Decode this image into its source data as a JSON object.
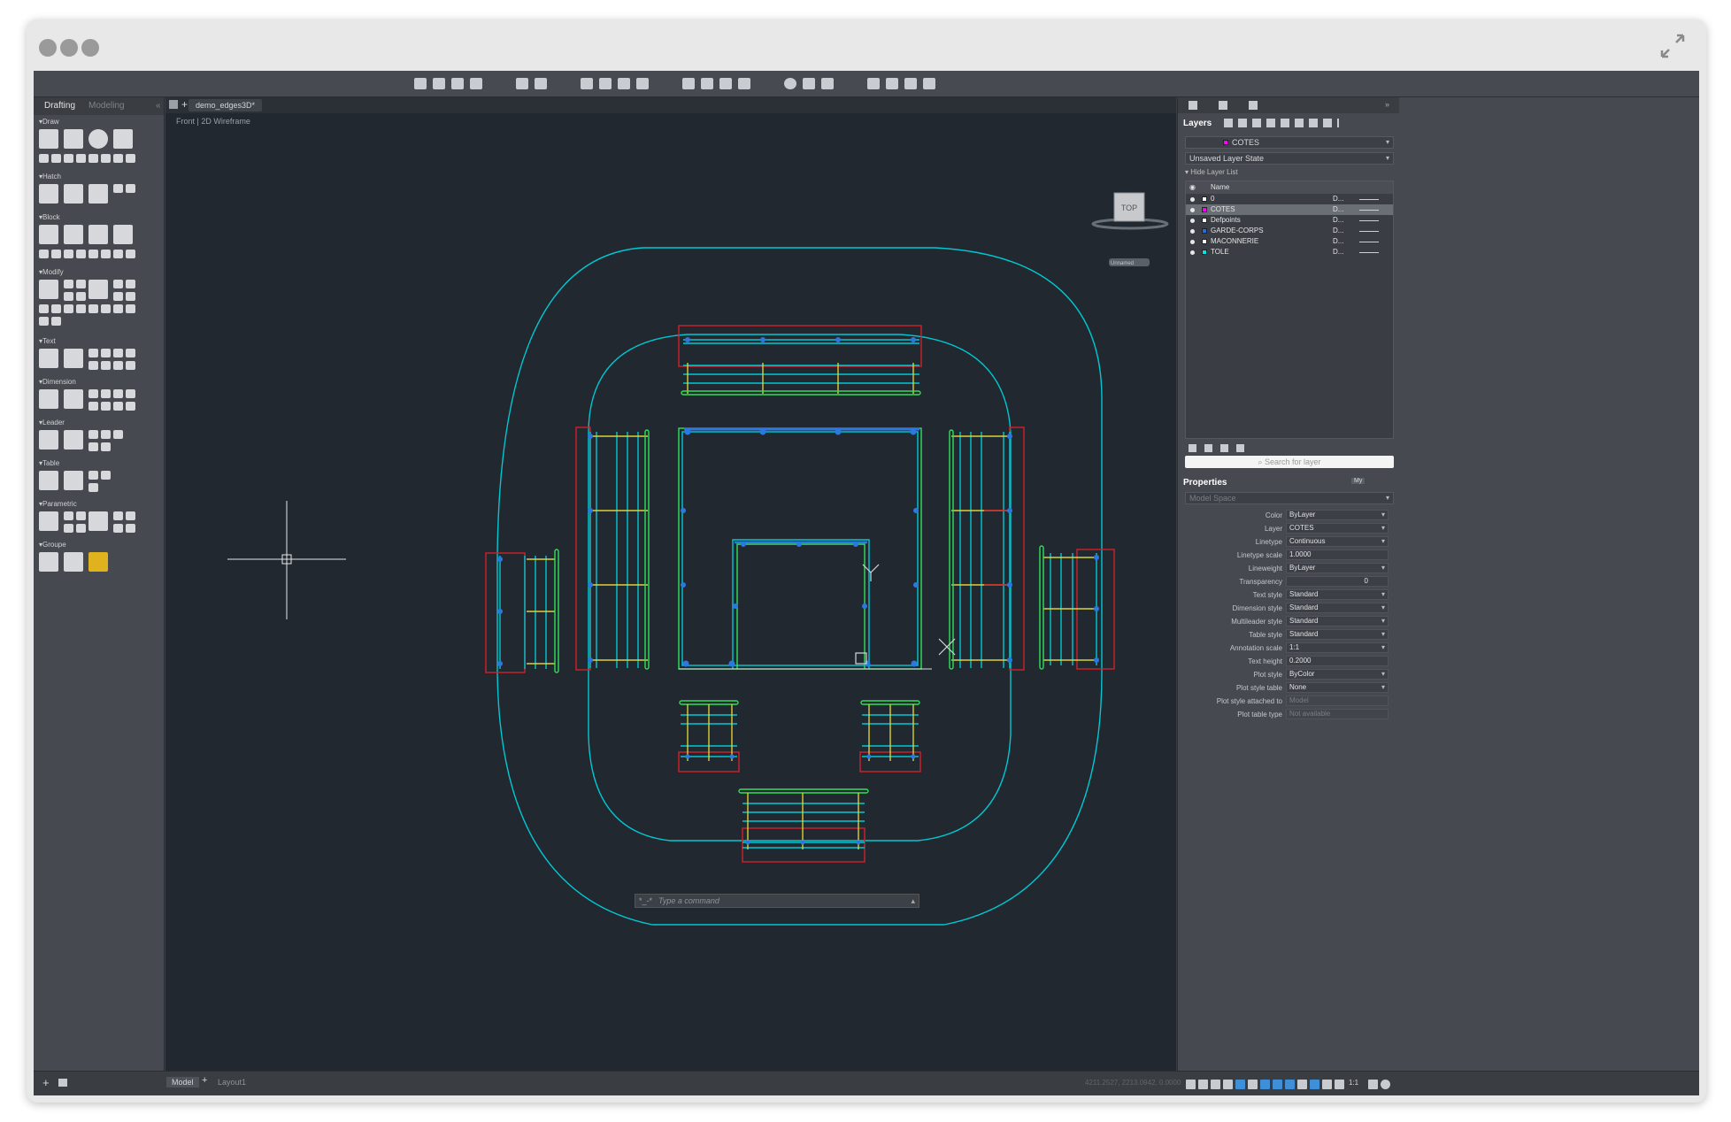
{
  "window": {
    "title": "demo_edges3D*"
  },
  "palette": {
    "tabs": [
      "Drafting",
      "Modeling"
    ],
    "sections": [
      "Draw",
      "Hatch",
      "Block",
      "Modify",
      "Text",
      "Dimension",
      "Leader",
      "Table",
      "Parametric",
      "Groupe"
    ]
  },
  "document": {
    "tab": "demo_edges3D*",
    "view_label": "Front | 2D Wireframe"
  },
  "viewcube": {
    "face": "TOP",
    "ucs": "Unnamed"
  },
  "command": {
    "prompt": "*_-*",
    "placeholder": "Type a command"
  },
  "layers": {
    "title": "Layers",
    "current": "COTES",
    "state": "Unsaved Layer State",
    "hide_list": "Hide Layer List",
    "header_name": "Name",
    "rows": [
      {
        "name": "0",
        "color": "#ffffff",
        "d": "D..."
      },
      {
        "name": "COTES",
        "color": "#ff00ff",
        "d": "D..."
      },
      {
        "name": "Defpoints",
        "color": "#ffffff",
        "d": "D..."
      },
      {
        "name": "GARDE-CORPS",
        "color": "#1e6fd8",
        "d": "D..."
      },
      {
        "name": "MACONNERIE",
        "color": "#ffffff",
        "d": "D..."
      },
      {
        "name": "TOLE",
        "color": "#00e5e5",
        "d": "D..."
      }
    ],
    "search_placeholder": "Search for layer"
  },
  "properties": {
    "title": "Properties",
    "toggle": "My",
    "space": "Model Space",
    "rows": [
      {
        "label": "Color",
        "value": "ByLayer"
      },
      {
        "label": "Layer",
        "value": "COTES"
      },
      {
        "label": "Linetype",
        "value": "Continuous"
      },
      {
        "label": "Linetype scale",
        "value": "1.0000"
      },
      {
        "label": "Lineweight",
        "value": "ByLayer"
      },
      {
        "label": "Transparency",
        "value": "0"
      },
      {
        "label": "Text style",
        "value": "Standard"
      },
      {
        "label": "Dimension style",
        "value": "Standard"
      },
      {
        "label": "Multileader style",
        "value": "Standard"
      },
      {
        "label": "Table style",
        "value": "Standard"
      },
      {
        "label": "Annotation scale",
        "value": "1:1"
      },
      {
        "label": "Text height",
        "value": "0.2000"
      },
      {
        "label": "Plot style",
        "value": "ByColor"
      },
      {
        "label": "Plot style table",
        "value": "None"
      },
      {
        "label": "Plot style attached to",
        "value": "Model"
      },
      {
        "label": "Plot table type",
        "value": "Not available"
      }
    ]
  },
  "status": {
    "model_tab": "Model",
    "layout_tab": "Layout1",
    "coords": "4211.2527, 2213.0942, 0.0000",
    "scale": "1:1"
  },
  "colors": {
    "cyan": "#00c8d2",
    "red": "#d2202a",
    "green": "#2fe05a",
    "yellow": "#d8d23a",
    "blue": "#2a78e0"
  }
}
